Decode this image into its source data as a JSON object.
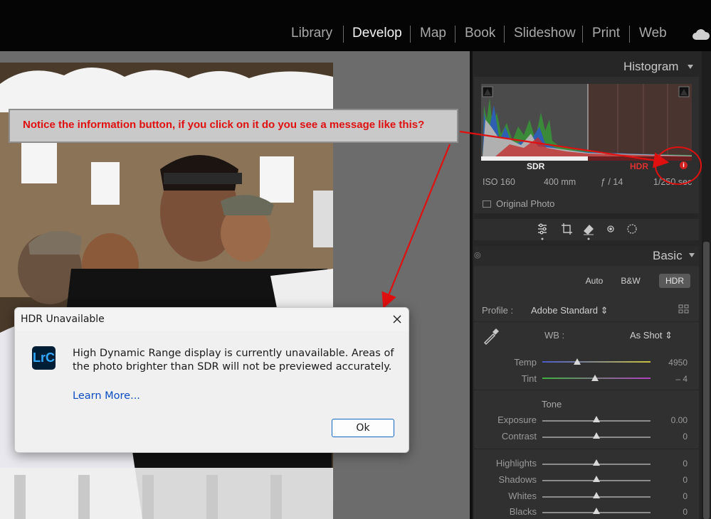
{
  "modules": [
    {
      "label": "Library",
      "active": false
    },
    {
      "label": "Develop",
      "active": true
    },
    {
      "label": "Map",
      "active": false
    },
    {
      "label": "Book",
      "active": false
    },
    {
      "label": "Slideshow",
      "active": false
    },
    {
      "label": "Print",
      "active": false
    },
    {
      "label": "Web",
      "active": false
    }
  ],
  "cloud_icon": "cloud-icon",
  "histogram": {
    "title": "Histogram",
    "sdr_label": "SDR",
    "hdr_label": "HDR",
    "info_icon": "info-icon",
    "iso": "ISO 160",
    "focal": "400 mm",
    "aperture": "ƒ / 14",
    "shutter": "1/250 sec",
    "original_photo": "Original Photo"
  },
  "tools": [
    "edit-sliders-icon",
    "crop-icon",
    "eraser-icon",
    "red-eye-icon",
    "masking-icon"
  ],
  "basic": {
    "title": "Basic",
    "auto": "Auto",
    "bw": "B&W",
    "hdr": "HDR",
    "profile_label": "Profile :",
    "profile_value": "Adobe Standard ⇕",
    "wb_label": "WB :",
    "wb_value": "As Shot ⇕",
    "tone_label": "Tone",
    "sliders": [
      {
        "label": "Temp",
        "value": "4950",
        "pos": 0.32
      },
      {
        "label": "Tint",
        "value": "– 4",
        "pos": 0.49
      },
      {
        "label": "Exposure",
        "value": "0.00",
        "pos": 0.5
      },
      {
        "label": "Contrast",
        "value": "0",
        "pos": 0.5
      },
      {
        "label": "Highlights",
        "value": "0",
        "pos": 0.5
      },
      {
        "label": "Shadows",
        "value": "0",
        "pos": 0.5
      },
      {
        "label": "Whites",
        "value": "0",
        "pos": 0.5
      },
      {
        "label": "Blacks",
        "value": "0",
        "pos": 0.5
      }
    ]
  },
  "annotation": {
    "text": "Notice the information button, if you click on it do you see a message like this?",
    "color": "#e01010"
  },
  "dialog": {
    "title": "HDR Unavailable",
    "icon_text": "LrC",
    "message": "High Dynamic Range display is currently unavailable. Areas of the photo brighter than SDR will not be previewed accurately.",
    "link": "Learn More...",
    "ok": "Ok"
  }
}
